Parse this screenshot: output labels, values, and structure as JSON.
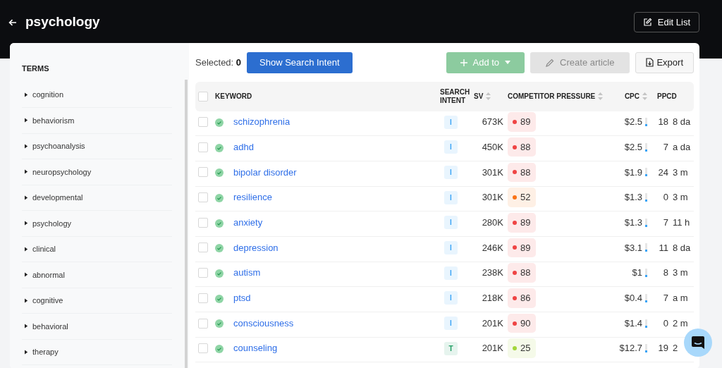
{
  "header": {
    "title": "psychology",
    "edit_button": "Edit List"
  },
  "sidebar": {
    "heading": "TERMS",
    "items": [
      {
        "label": "cognition",
        "expanded": false
      },
      {
        "label": "behaviorism",
        "expanded": false
      },
      {
        "label": "psychoanalysis",
        "expanded": false
      },
      {
        "label": "neuropsychology",
        "expanded": false
      },
      {
        "label": "developmental",
        "expanded": false
      },
      {
        "label": "psychology",
        "expanded": false
      },
      {
        "label": "clinical",
        "expanded": false
      },
      {
        "label": "abnormal",
        "expanded": false
      },
      {
        "label": "cognitive",
        "expanded": false
      },
      {
        "label": "behavioral",
        "expanded": false
      },
      {
        "label": "therapy",
        "expanded": false
      }
    ]
  },
  "toolbar": {
    "selected_label": "Selected:",
    "selected_count": "0",
    "show_intent_button": "Show Search Intent",
    "add_button": "Add to",
    "create_button": "Create article",
    "create_disabled": true,
    "export_button": "Export"
  },
  "table": {
    "columns": [
      "KEYWORD",
      "SEARCH INTENT",
      "SV",
      "COMPETITOR PRESSURE",
      "CPC",
      "PPCD"
    ],
    "sortable": [
      false,
      false,
      true,
      true,
      true,
      false
    ],
    "all_checked": false,
    "rows": [
      {
        "checked": false,
        "keyword": "schizophrenia",
        "intent": {
          "label": "I",
          "color": "#3ba4f5"
        },
        "sv": "673K",
        "pressure": {
          "value": "89",
          "color": "#ef4444"
        },
        "cpc": "$2.5",
        "ppcd": "18",
        "column_8": "8 da"
      },
      {
        "checked": false,
        "keyword": "adhd",
        "intent": {
          "label": "I",
          "color": "#3ba4f5"
        },
        "sv": "450K",
        "pressure": {
          "value": "88",
          "color": "#ef4444"
        },
        "cpc": "$2.5",
        "ppcd": "7",
        "column_8": "a da"
      },
      {
        "checked": false,
        "keyword": "bipolar disorder",
        "intent": {
          "label": "I",
          "color": "#3ba4f5"
        },
        "sv": "301K",
        "pressure": {
          "value": "88",
          "color": "#ef4444"
        },
        "cpc": "$1.9",
        "ppcd": "24",
        "column_8": "3 m"
      },
      {
        "checked": false,
        "keyword": "resilience",
        "intent": {
          "label": "I",
          "color": "#3ba4f5"
        },
        "sv": "301K",
        "pressure": {
          "value": "52",
          "color": "#f97316"
        },
        "cpc": "$1.3",
        "ppcd": "0",
        "column_8": "3 m"
      },
      {
        "checked": false,
        "keyword": "anxiety",
        "intent": {
          "label": "I",
          "color": "#3ba4f5"
        },
        "sv": "280K",
        "pressure": {
          "value": "89",
          "color": "#ef4444"
        },
        "cpc": "$1.3",
        "ppcd": "7",
        "column_8": "11 h"
      },
      {
        "checked": false,
        "keyword": "depression",
        "intent": {
          "label": "I",
          "color": "#3ba4f5"
        },
        "sv": "246K",
        "pressure": {
          "value": "89",
          "color": "#ef4444"
        },
        "cpc": "$3.1",
        "ppcd": "11",
        "column_8": "8 da"
      },
      {
        "checked": false,
        "keyword": "autism",
        "intent": {
          "label": "I",
          "color": "#3ba4f5"
        },
        "sv": "238K",
        "pressure": {
          "value": "88",
          "color": "#ef4444"
        },
        "cpc": "$1",
        "ppcd": "8",
        "column_8": "3 m"
      },
      {
        "checked": false,
        "keyword": "ptsd",
        "intent": {
          "label": "I",
          "color": "#3ba4f5"
        },
        "sv": "218K",
        "pressure": {
          "value": "86",
          "color": "#ef4444"
        },
        "cpc": "$0.4",
        "ppcd": "7",
        "column_8": "a m"
      },
      {
        "checked": false,
        "keyword": "consciousness",
        "intent": {
          "label": "I",
          "color": "#3ba4f5"
        },
        "sv": "201K",
        "pressure": {
          "value": "90",
          "color": "#ef4444"
        },
        "cpc": "$1.4",
        "ppcd": "0",
        "column_8": "2 m"
      },
      {
        "checked": false,
        "keyword": "counseling",
        "intent": {
          "label": "T",
          "color": "#1f9d63"
        },
        "sv": "201K",
        "pressure": {
          "value": "25",
          "color": "#a3d63a"
        },
        "cpc": "$12.7",
        "ppcd": "19",
        "column_8": "2"
      }
    ]
  }
}
